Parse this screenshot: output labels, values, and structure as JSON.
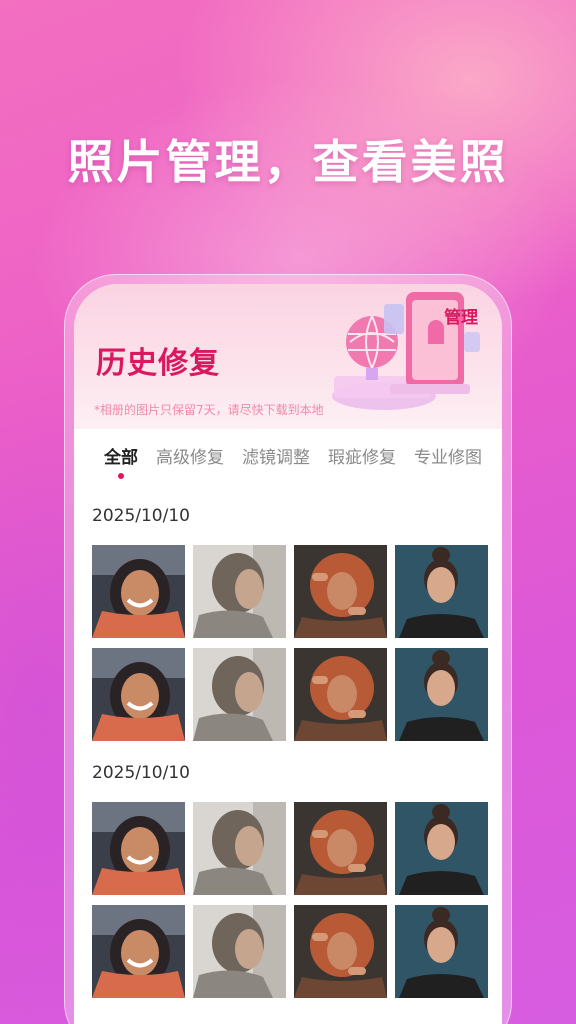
{
  "headline": "照片管理，查看美照",
  "screen": {
    "title": "历史修复",
    "badge": "管理",
    "notice": "*相册的图片只保留7天，请尽快下载到本地",
    "tabs": [
      {
        "label": "全部",
        "active": true
      },
      {
        "label": "高级修复",
        "active": false
      },
      {
        "label": "滤镜调整",
        "active": false
      },
      {
        "label": "瑕疵修复",
        "active": false
      },
      {
        "label": "专业修图",
        "active": false
      }
    ],
    "sections": [
      {
        "date": "2025/10/10"
      },
      {
        "date": "2025/10/10"
      }
    ],
    "photos": [
      "laughing-woman-hijab-photo",
      "woman-profile-photo",
      "curly-hair-woman-hands-photo",
      "woman-portrait-teal-photo"
    ]
  },
  "colors": {
    "accent": "#d9185f",
    "background": "#ec5fc8"
  }
}
